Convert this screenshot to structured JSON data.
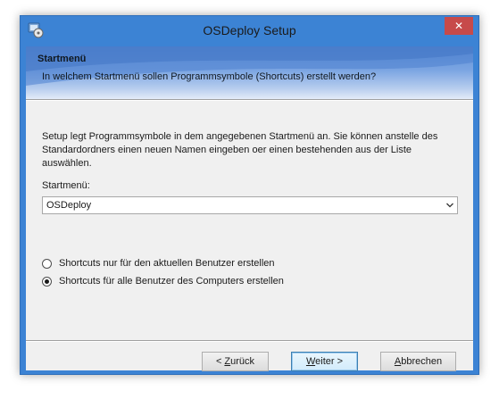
{
  "window": {
    "title": "OSDeploy Setup",
    "close_glyph": "✕",
    "accent": "#3c83d4",
    "close_color": "#c74a4a"
  },
  "header": {
    "title": "Startmenü",
    "subtitle": "In welchem Startmenü sollen Programmsymbole (Shortcuts) erstellt werden?"
  },
  "body": {
    "description": "Setup legt Programmsymbole in dem angegebenen Startmenü an. Sie können anstelle des Standardordners einen neuen Namen eingeben oer einen bestehenden aus der Liste auswählen.",
    "combo_label": "Startmenü:",
    "combo_value": "OSDeploy",
    "options": [
      {
        "label": "Shortcuts nur für den aktuellen Benutzer erstellen",
        "selected": false
      },
      {
        "label": "Shortcuts für alle Benutzer des Computers erstellen",
        "selected": true
      }
    ]
  },
  "buttons": {
    "back": {
      "prefix": "< ",
      "accel": "Z",
      "rest": "urück"
    },
    "next": {
      "accel": "W",
      "rest": "eiter >"
    },
    "cancel": {
      "accel": "A",
      "rest": "bbrechen"
    }
  }
}
